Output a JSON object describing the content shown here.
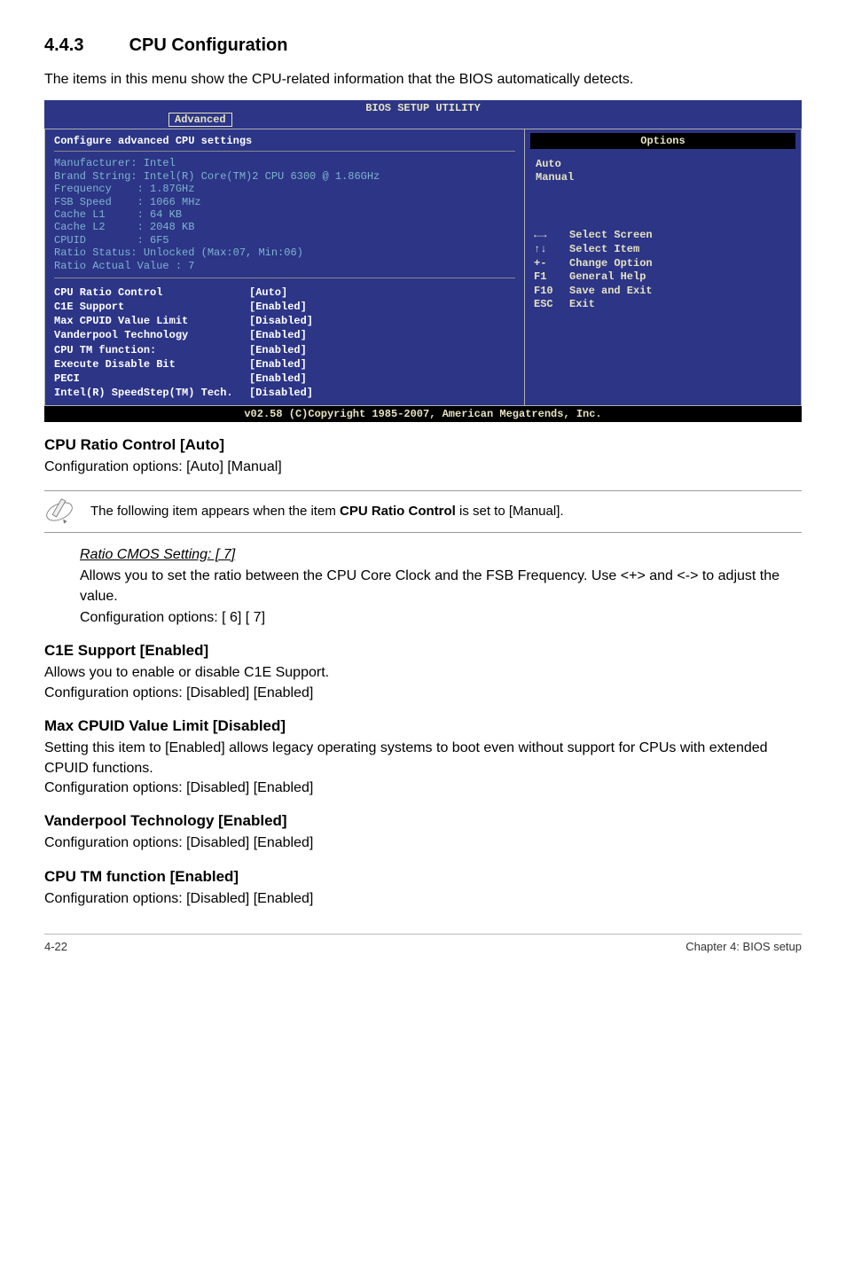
{
  "section": {
    "number": "4.4.3",
    "title": "CPU Configuration",
    "intro": "The items in this menu show the CPU-related information that the BIOS automatically detects."
  },
  "bios": {
    "title": "BIOS SETUP UTILITY",
    "active_tab": "Advanced",
    "left_heading": "Configure advanced CPU settings",
    "info_lines": [
      "Manufacturer: Intel",
      "Brand String: Intel(R) Core(TM)2 CPU 6300 @ 1.86GHz",
      "Frequency    : 1.87GHz",
      "FSB Speed    : 1066 MHz",
      "Cache L1     : 64 KB",
      "Cache L2     : 2048 KB",
      "CPUID        : 6F5",
      "Ratio Status: Unlocked (Max:07, Min:06)",
      "Ratio Actual Value : 7"
    ],
    "settings": [
      {
        "k": "CPU Ratio Control",
        "v": "[Auto]"
      },
      {
        "k": "C1E Support",
        "v": "[Enabled]"
      },
      {
        "k": "Max CPUID Value Limit",
        "v": "[Disabled]"
      },
      {
        "k": "Vanderpool Technology",
        "v": "[Enabled]"
      },
      {
        "k": "CPU TM function:",
        "v": "[Enabled]"
      },
      {
        "k": "Execute Disable Bit",
        "v": "[Enabled]"
      },
      {
        "k": "PECI",
        "v": "[Enabled]"
      },
      {
        "k": "Intel(R) SpeedStep(TM) Tech.",
        "v": "[Disabled]"
      }
    ],
    "options_header": "Options",
    "options": [
      "Auto",
      "Manual"
    ],
    "help": [
      {
        "sym_name": "arrows-lr",
        "txt": "Select Screen"
      },
      {
        "sym_name": "arrows-ud",
        "txt": "Select Item"
      },
      {
        "sym": "+-",
        "txt": "Change Option"
      },
      {
        "sym": "F1",
        "txt": "General Help"
      },
      {
        "sym": "F10",
        "txt": "Save and Exit"
      },
      {
        "sym": "ESC",
        "txt": "Exit"
      }
    ],
    "footer": "v02.58 (C)Copyright 1985-2007, American Megatrends, Inc."
  },
  "sections": {
    "cpu_ratio": {
      "h": "CPU Ratio Control [Auto]",
      "p": "Configuration options: [Auto] [Manual]"
    },
    "note": {
      "pre": "The following item appears when the item ",
      "bold": "CPU Ratio Control",
      "post": " is set to [Manual]."
    },
    "ratio_cmos": {
      "h": "Ratio CMOS Setting: [ 7]",
      "p1": "Allows you to set the ratio between the CPU Core Clock and the FSB Frequency. Use <+> and <-> to adjust the value.",
      "p2": "Configuration options: [ 6] [ 7]"
    },
    "c1e": {
      "h": "C1E Support [Enabled]",
      "p": "Allows you to enable or disable C1E Support.\nConfiguration options: [Disabled] [Enabled]"
    },
    "max_cpuid": {
      "h": "Max CPUID Value Limit [Disabled]",
      "p": "Setting this item to [Enabled] allows legacy operating systems to boot even without support for CPUs with extended CPUID functions.\nConfiguration options: [Disabled] [Enabled]"
    },
    "vanderpool": {
      "h": "Vanderpool Technology [Enabled]",
      "p": "Configuration options: [Disabled] [Enabled]"
    },
    "cpu_tm": {
      "h": "CPU TM function [Enabled]",
      "p": "Configuration options: [Disabled] [Enabled]"
    }
  },
  "footer": {
    "left": "4-22",
    "right": "Chapter 4: BIOS setup"
  }
}
